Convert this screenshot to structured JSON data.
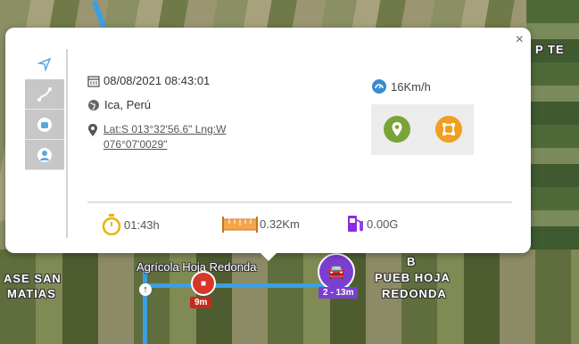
{
  "popup": {
    "close_label": "×",
    "datetime": "08/08/2021 08:43:01",
    "location": "Ica, Perú",
    "coords_line1": "Lat:S 013°32'56.6\" Lng:W",
    "coords_line2": "076°07'0029\"",
    "speed": "16Km/h",
    "stats": {
      "duration": "01:43h",
      "distance": "0.32Km",
      "fuel": "0.00G"
    }
  },
  "sidebar": {
    "tabs": [
      {
        "icon": "navigation-arrow-icon",
        "active": true
      },
      {
        "icon": "route-icon",
        "active": false
      },
      {
        "icon": "car-icon",
        "active": false
      },
      {
        "icon": "driver-icon",
        "active": false
      }
    ]
  },
  "map": {
    "labels": {
      "top_right": "P TE",
      "left_line1": "ASE SAN",
      "left_line2": "MATIAS",
      "center": "Agrícola Hoja Redonda",
      "right_b": "B",
      "right_line1": "PUEB HOJA",
      "right_line2": "REDONDA"
    },
    "markers": {
      "stop_time": "9m",
      "cluster_label": "2 - 13m"
    }
  },
  "colors": {
    "accent_blue": "#3a8ad0",
    "location_green": "#7aa33a",
    "geofence_orange": "#f0a020",
    "timer_yellow": "#e8b400",
    "fuel_purple": "#8a2be2",
    "stop_red": "#d9362b"
  }
}
